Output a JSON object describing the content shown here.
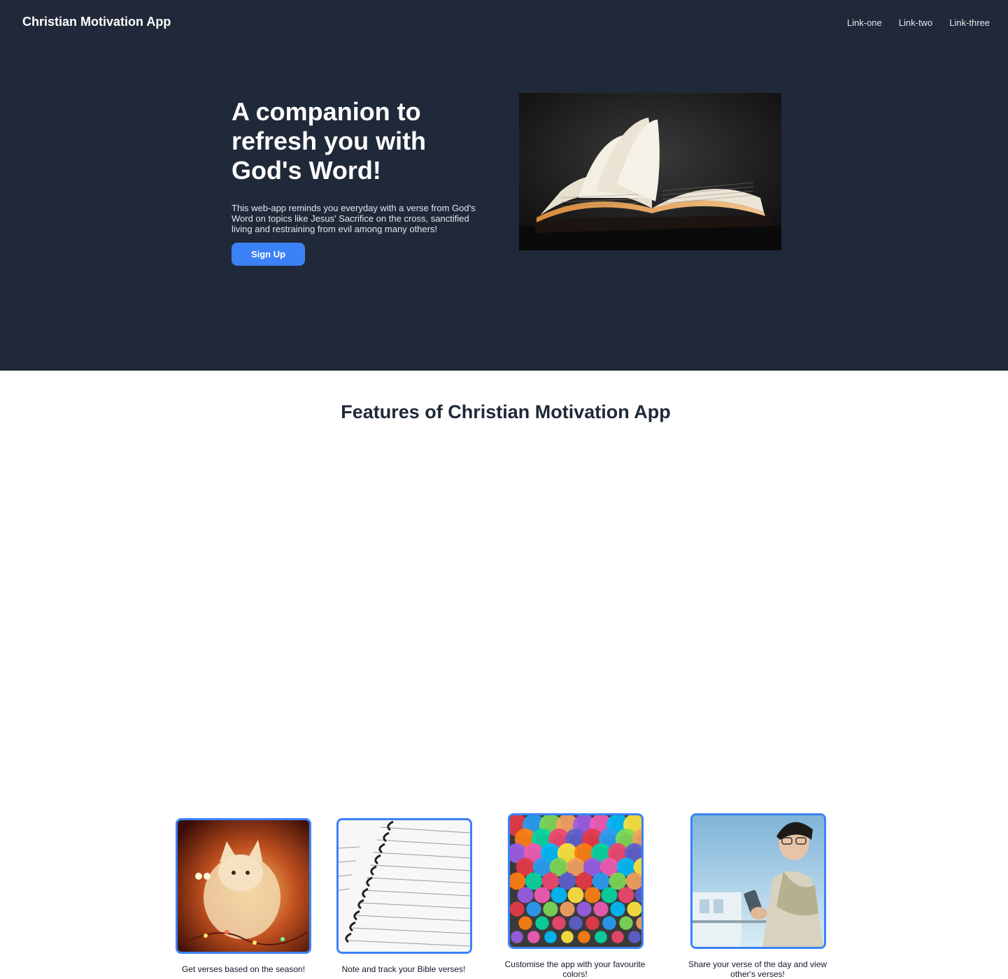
{
  "header": {
    "brand": "Christian Motivation App",
    "links": [
      "Link-one",
      "Link-two",
      "Link-three"
    ]
  },
  "hero": {
    "headline": "A companion to refresh you with God's Word!",
    "description": "This web-app reminds you everyday with a verse from God's Word on topics like Jesus' Sacrifice on the cross, sanctified living and restraining from evil among many others!",
    "signup_label": "Sign Up"
  },
  "features": {
    "title": "Features of Christian Motivation App",
    "items": [
      {
        "caption": "Get verses based on the season!",
        "image": "kitten-with-lights"
      },
      {
        "caption": "Note and track your Bible verses!",
        "image": "spiral-notebook"
      },
      {
        "caption": "Customise the app with your favourite colors!",
        "image": "colorful-umbrellas"
      },
      {
        "caption": "Share your verse of the day and view other's verses!",
        "image": "person-with-phone"
      }
    ]
  },
  "colors": {
    "hero_bg": "#202939",
    "accent": "#3b82f6"
  }
}
